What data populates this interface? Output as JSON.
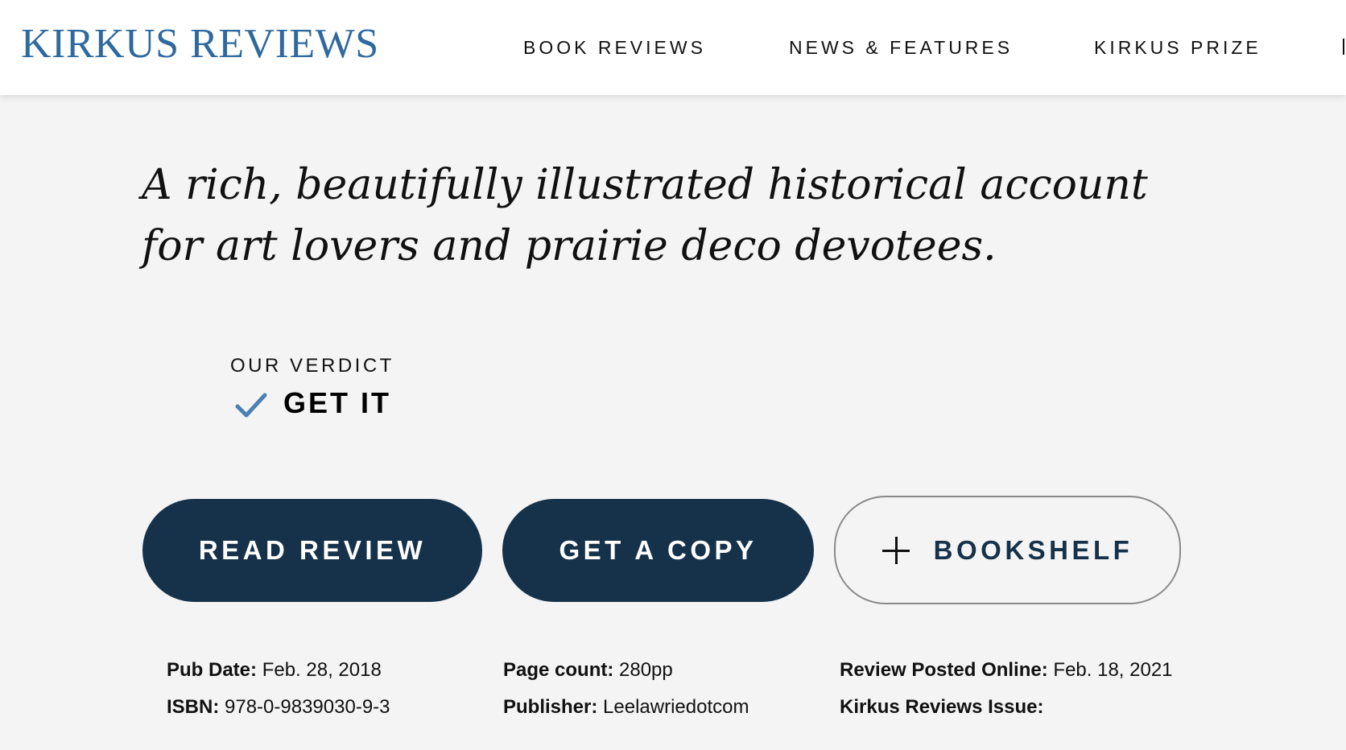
{
  "header": {
    "logo": "KIRKUS REVIEWS",
    "nav": [
      {
        "label": "BOOK REVIEWS"
      },
      {
        "label": "NEWS & FEATURES"
      },
      {
        "label": "KIRKUS PRIZE"
      }
    ]
  },
  "review": {
    "tagline": "A rich, beautifully illustrated historical account for art lovers and prairie deco devotees.",
    "verdict": {
      "label": "OUR VERDICT",
      "value": "GET IT",
      "icon": "checkmark-icon"
    }
  },
  "actions": {
    "read_review": "READ REVIEW",
    "get_a_copy": "GET A COPY",
    "bookshelf": "BOOKSHELF",
    "bookshelf_icon": "plus-icon"
  },
  "details": {
    "pub_date_label": "Pub Date:",
    "pub_date": "Feb. 28, 2018",
    "isbn_label": "ISBN:",
    "isbn": "978-0-9839030-9-3",
    "page_count_label": "Page count:",
    "page_count": "280pp",
    "publisher_label": "Publisher:",
    "publisher": "Leelawriedotcom",
    "review_posted_label": "Review Posted Online:",
    "review_posted": "Feb. 18, 2021",
    "issue_label": "Kirkus Reviews Issue:",
    "issue": ""
  },
  "colors": {
    "brand_blue": "#2e6a9e",
    "button_navy": "#16324b",
    "page_bg": "#f4f4f4",
    "check_blue": "#4a80b6"
  }
}
